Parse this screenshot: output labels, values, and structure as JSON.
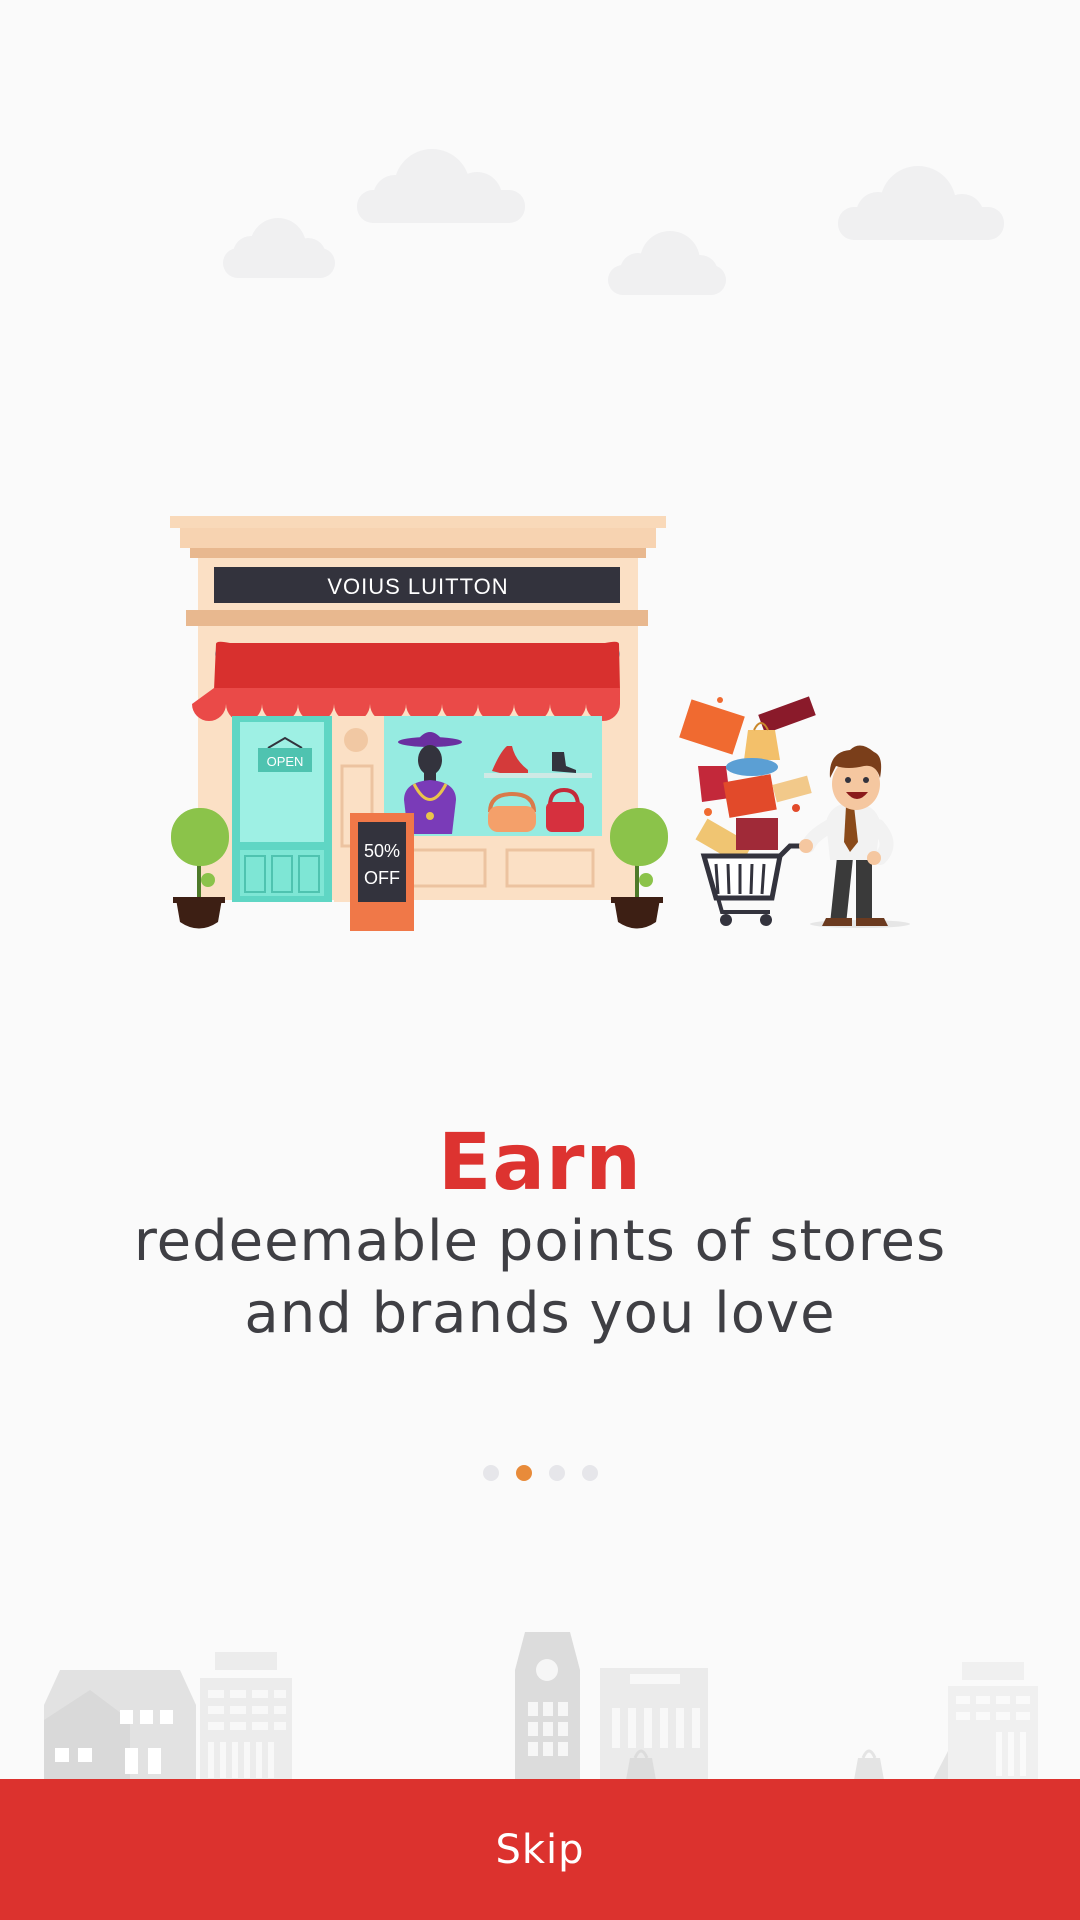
{
  "illustration": {
    "store_sign": "VOIUS LUITTON",
    "door_sign": "OPEN",
    "sale_board_line1": "50%",
    "sale_board_line2": "OFF"
  },
  "onboarding": {
    "headline": "Earn",
    "subline_1": "redeemable points of stores",
    "subline_2": "and brands you love"
  },
  "pager": {
    "total": 4,
    "active_index": 1
  },
  "footer": {
    "skip_label": "Skip"
  },
  "colors": {
    "accent_red": "#dc322e",
    "active_dot": "#e88b3a",
    "inactive_dot": "#e6e6ea",
    "text_dark": "#3f3f44"
  }
}
